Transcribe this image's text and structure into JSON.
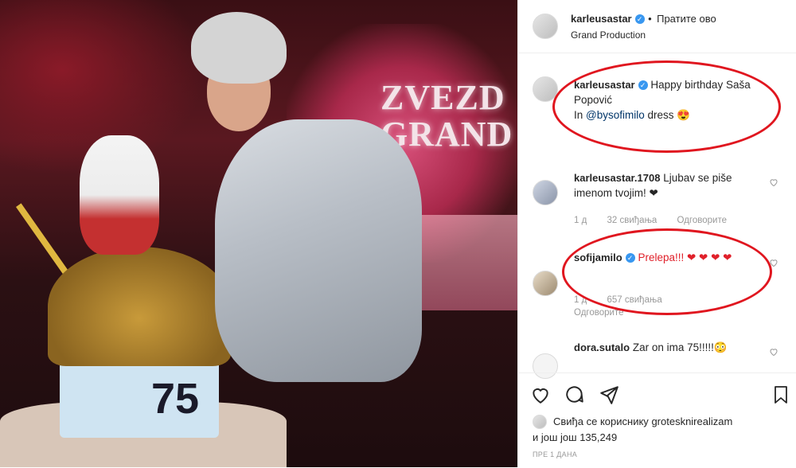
{
  "photo": {
    "sign_text": "ZVEZD\nGRAND",
    "cake_number": "75"
  },
  "header": {
    "username": "karleusastar",
    "follow_label": "Пратите ово",
    "location": "Grand Production"
  },
  "caption": {
    "username": "karleusastar",
    "text": "Happy birthday Saša Popović",
    "line2_prefix": "In ",
    "mention": "@bysofimilo",
    "line2_suffix": " dress 😍"
  },
  "comments": [
    {
      "username": "karleusastar.1708",
      "text": "Ljubav se piše imenom tvojim! ❤",
      "age": "1 д",
      "likes": "32 свиђања",
      "reply_label": "Одговорите"
    },
    {
      "username": "sofijamilo",
      "text": "Prelepa!!! ❤ ❤ ❤ ❤",
      "age": "1 д",
      "likes": "657 свиђања",
      "reply_label": "Одговорите"
    },
    {
      "username": "dora.sutalo",
      "text": "Zar on ima 75!!!!!😳"
    }
  ],
  "likes": {
    "prefix": "Свиђа се кориснику",
    "user": "grotesknirealizam",
    "more": "и још још 135,249"
  },
  "timestamp": "ПРЕ 1 ДАНА",
  "colors": {
    "annotation": "#e0161f",
    "verified": "#3897f0",
    "heart": "#e0202a"
  },
  "icons": [
    "heart-icon",
    "comment-icon",
    "share-icon",
    "bookmark-icon",
    "verified-icon"
  ]
}
